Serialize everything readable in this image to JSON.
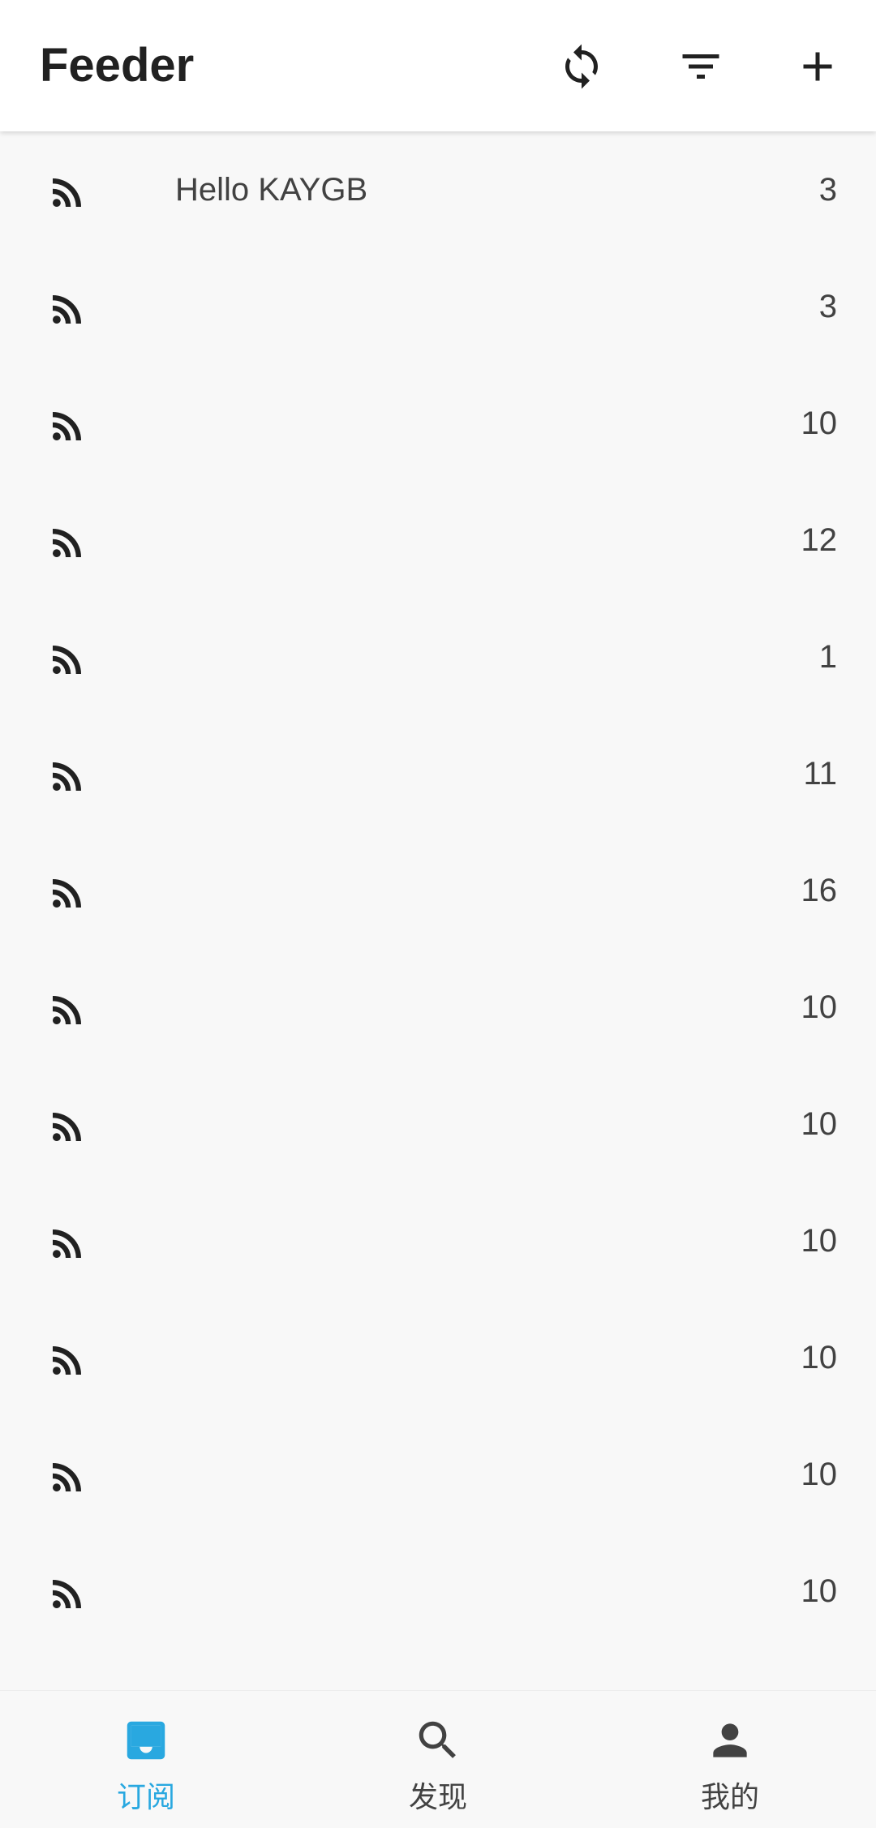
{
  "appbar": {
    "title": "Feeder",
    "actions": [
      {
        "icon": "refresh-icon"
      },
      {
        "icon": "filter-icon"
      },
      {
        "icon": "add-icon"
      }
    ]
  },
  "feeds": [
    {
      "title": "Hello KAYGB",
      "count": "3"
    },
    {
      "title": "",
      "count": "3"
    },
    {
      "title": "",
      "count": "10"
    },
    {
      "title": "",
      "count": "12"
    },
    {
      "title": "",
      "count": "1"
    },
    {
      "title": "",
      "count": "11"
    },
    {
      "title": "",
      "count": "16"
    },
    {
      "title": "",
      "count": "10"
    },
    {
      "title": "",
      "count": "10"
    },
    {
      "title": "",
      "count": "10"
    },
    {
      "title": "",
      "count": "10"
    },
    {
      "title": "",
      "count": "10"
    },
    {
      "title": "",
      "count": "10"
    }
  ],
  "bottom_nav": {
    "items": [
      {
        "label": "订阅",
        "icon": "inbox-icon",
        "active": true
      },
      {
        "label": "发现",
        "icon": "search-icon",
        "active": false
      },
      {
        "label": "我的",
        "icon": "person-icon",
        "active": false
      }
    ]
  },
  "colors": {
    "accent": "#29a8e0",
    "text": "#424242",
    "appbar_bg": "#ffffff",
    "page_bg": "#f8f8f8"
  }
}
